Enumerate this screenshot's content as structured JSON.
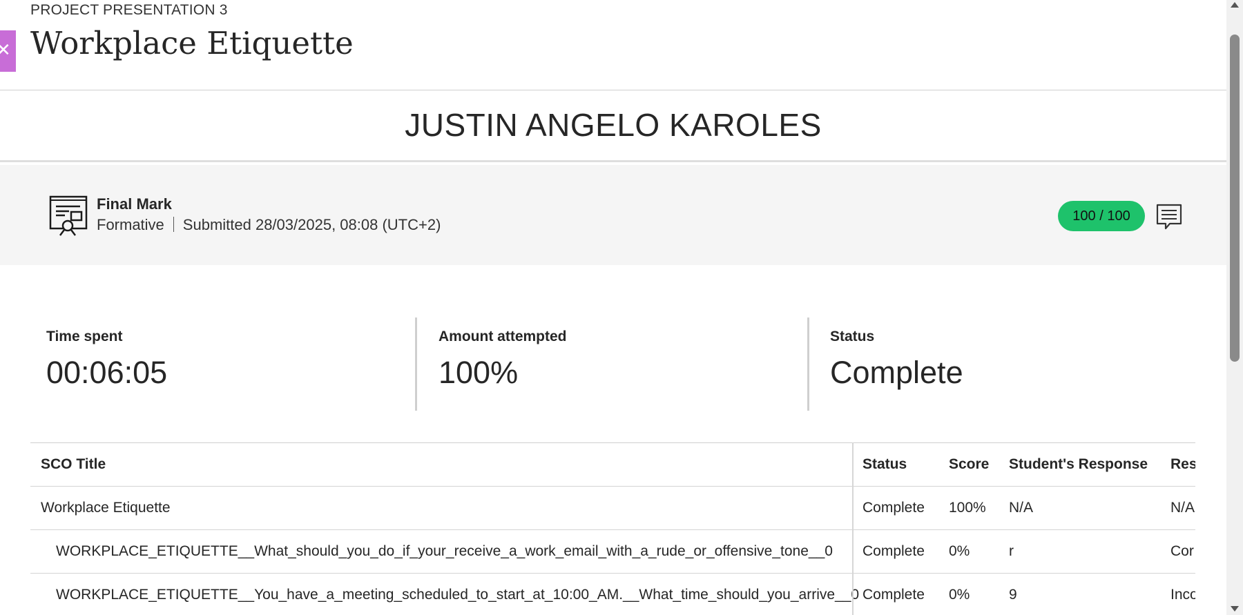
{
  "header": {
    "overline": "PROJECT PRESENTATION 3",
    "title": "Workplace Etiquette"
  },
  "student_name": "JUSTIN ANGELO KAROLES",
  "grade": {
    "title": "Final Mark",
    "type": "Formative",
    "submitted": "Submitted 28/03/2025, 08:08 (UTC+2)",
    "score": "100 / 100",
    "score_color": "#1ec26b"
  },
  "stats": [
    {
      "label": "Time spent",
      "value": "00:06:05"
    },
    {
      "label": "Amount attempted",
      "value": "100%"
    },
    {
      "label": "Status",
      "value": "Complete"
    }
  ],
  "table": {
    "columns": [
      "SCO Title",
      "Status",
      "Score",
      "Student's Response",
      "Res"
    ],
    "rows": [
      {
        "title": "Workplace Etiquette",
        "status": "Complete",
        "score": "100%",
        "response": "N/A",
        "result": "N/A"
      },
      {
        "title": "WORKPLACE_ETIQUETTE__What_should_you_do_if_your_receive_a_work_email_with_a_rude_or_offensive_tone__0",
        "status": "Complete",
        "score": "0%",
        "response": "r",
        "result": "Cor"
      },
      {
        "title": "WORKPLACE_ETIQUETTE__You_have_a_meeting_scheduled_to_start_at_10:00_AM.__What_time_should_you_arrive__0",
        "status": "Complete",
        "score": "0%",
        "response": "9",
        "result": "Inco"
      }
    ]
  },
  "icons": {
    "close": "close-icon",
    "certificate": "certificate-icon",
    "feedback": "feedback-icon"
  }
}
